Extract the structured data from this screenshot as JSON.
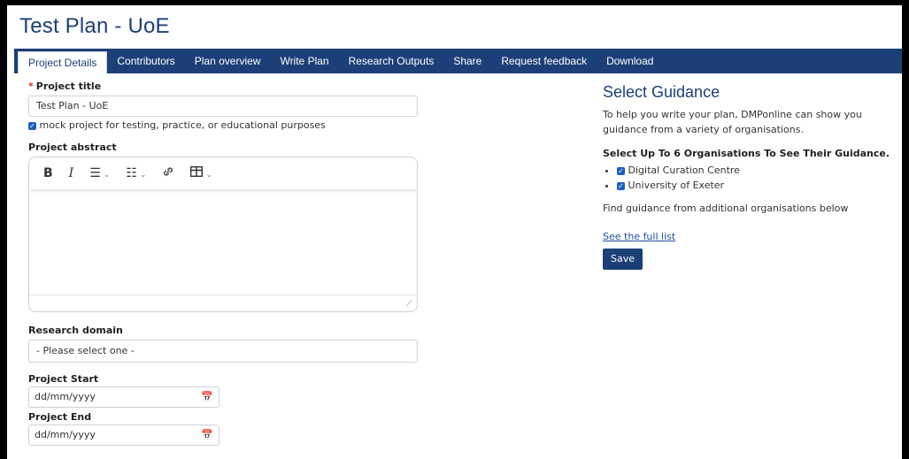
{
  "page": {
    "title": "Test Plan - UoE"
  },
  "nav": {
    "tabs": [
      {
        "label": "Project Details"
      },
      {
        "label": "Contributors"
      },
      {
        "label": "Plan overview"
      },
      {
        "label": "Write Plan"
      },
      {
        "label": "Research Outputs"
      },
      {
        "label": "Share"
      },
      {
        "label": "Request feedback"
      },
      {
        "label": "Download"
      }
    ]
  },
  "form": {
    "project_title_label": "Project title",
    "required_marker": "*",
    "project_title_value": "Test Plan - UoE",
    "mock_label": "mock project for testing, practice, or educational purposes",
    "abstract_label": "Project abstract",
    "toolbar": {
      "bold": "B",
      "italic": "I"
    },
    "research_domain_label": "Research domain",
    "research_domain_value": "- Please select one -",
    "start_label": "Project Start",
    "start_placeholder": "dd/mm/yyyy",
    "end_label": "Project End",
    "end_placeholder": "dd/mm/yyyy"
  },
  "guidance": {
    "title": "Select Guidance",
    "intro": "To help you write your plan, DMPonline can show you guidance from a variety of organisations.",
    "select_heading": "Select Up To 6 Organisations To See Their Guidance.",
    "orgs": [
      {
        "label": "Digital Curation Centre",
        "checked": true
      },
      {
        "label": "University of Exeter",
        "checked": true
      }
    ],
    "additional": "Find guidance from additional organisations below",
    "full_list_link": "See the full list",
    "save_label": "Save"
  },
  "colors": {
    "brand": "#1c3f77",
    "checkbox": "#1d5fbf",
    "required": "#c0392b"
  }
}
